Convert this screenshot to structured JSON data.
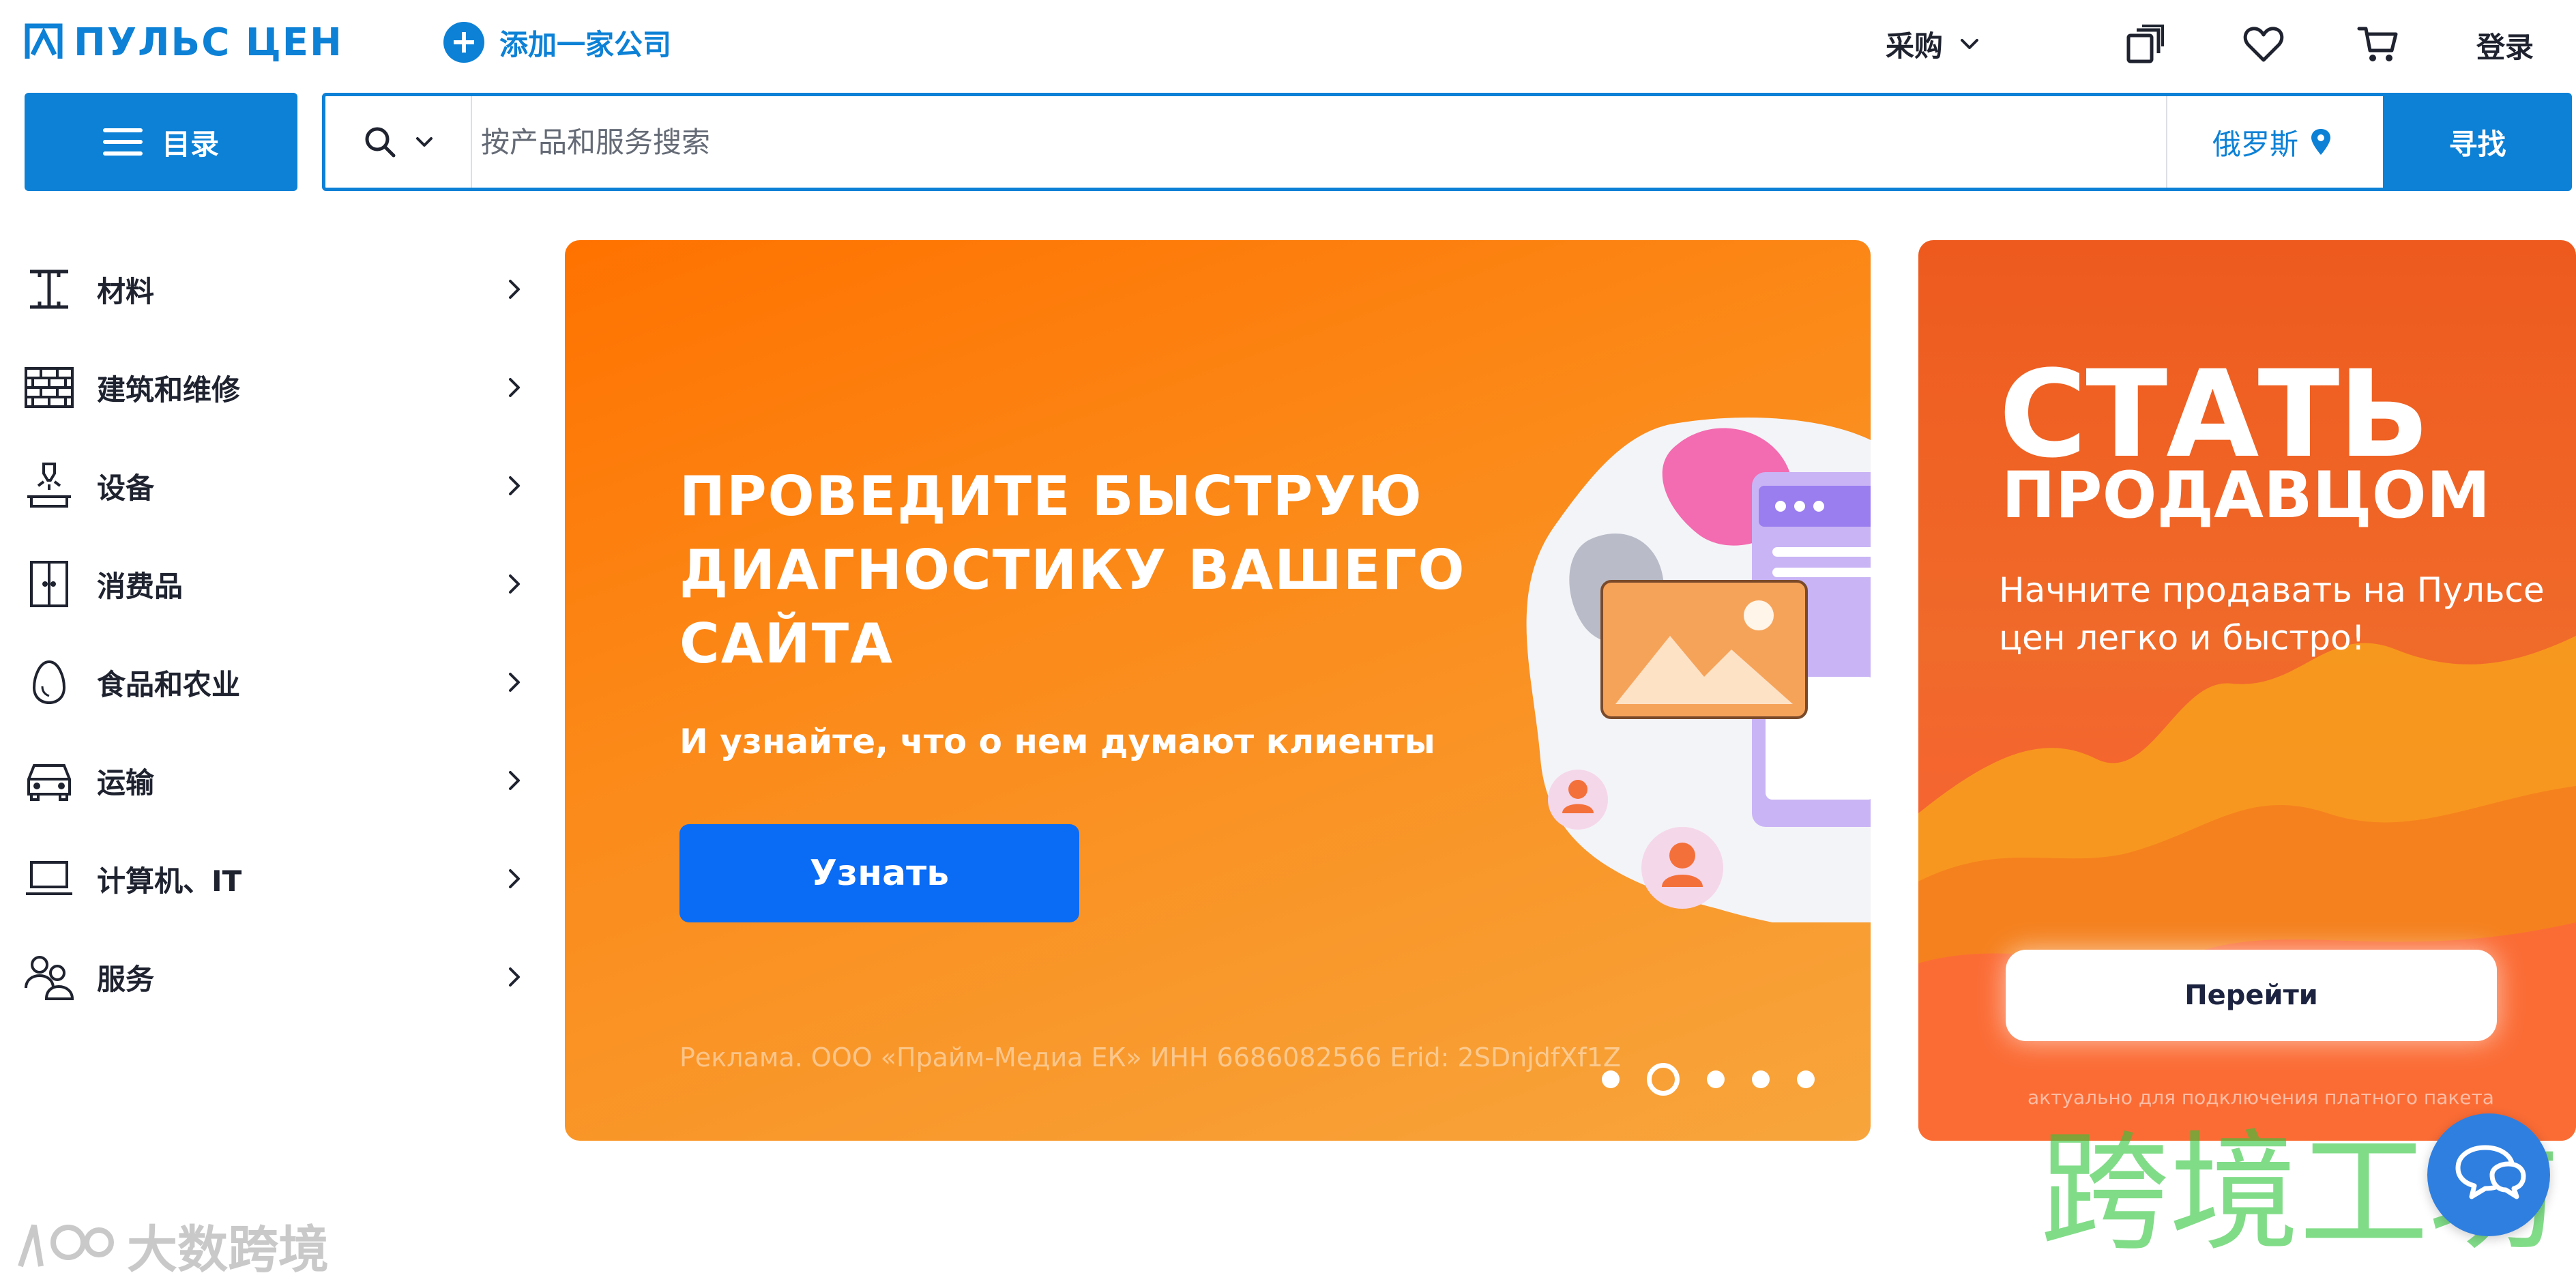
{
  "header": {
    "logo_text": "ПУЛЬС ЦЕН",
    "add_company_label": "添加一家公司",
    "purchase_label": "采购",
    "login_label": "登录",
    "icons": [
      "compare-icon",
      "heart-icon",
      "cart-icon"
    ]
  },
  "search": {
    "catalog_label": "目录",
    "placeholder": "按产品和服务搜索",
    "region_label": "俄罗斯",
    "find_label": "寻找"
  },
  "sidebar": {
    "items": [
      {
        "label": "材料",
        "icon": "i-beam-icon"
      },
      {
        "label": "建筑和维修",
        "icon": "brick-wall-icon"
      },
      {
        "label": "设备",
        "icon": "press-machine-icon"
      },
      {
        "label": "消费品",
        "icon": "wardrobe-icon"
      },
      {
        "label": "食品和农业",
        "icon": "egg-icon"
      },
      {
        "label": "运输",
        "icon": "car-icon"
      },
      {
        "label": "计算机、IT",
        "icon": "laptop-icon"
      },
      {
        "label": "服务",
        "icon": "people-icon"
      }
    ]
  },
  "banner": {
    "title": "ПРОВЕДИТЕ БЫСТРУЮ ДИАГНОСТИКУ ВАШЕГО САЙТА",
    "subtitle": "И узнайте, что о нем думают клиенты",
    "button_label": "Узнать",
    "disclaimer": "Реклама. ООО «Прайм-Медиа ЕК» ИНН 6686082566 Erid: 2SDnjdfXf1Z",
    "slide_count": 5,
    "active_slide": 2,
    "bg_color": "#ff8a12",
    "button_color": "#0a6cf5"
  },
  "side_banner": {
    "title_line1": "СТАТЬ",
    "title_line2": "ПРОДАВЦОМ",
    "text": "Начните продавать на Пульсе цен легко и быстро!",
    "button_label": "Перейти",
    "note": "актуально для подключения платного пакета"
  },
  "watermarks": {
    "corner_text": "大数跨境",
    "center_text": "跨境工坊"
  },
  "colors": {
    "brand": "#0c81d6",
    "text": "#1f2330"
  }
}
